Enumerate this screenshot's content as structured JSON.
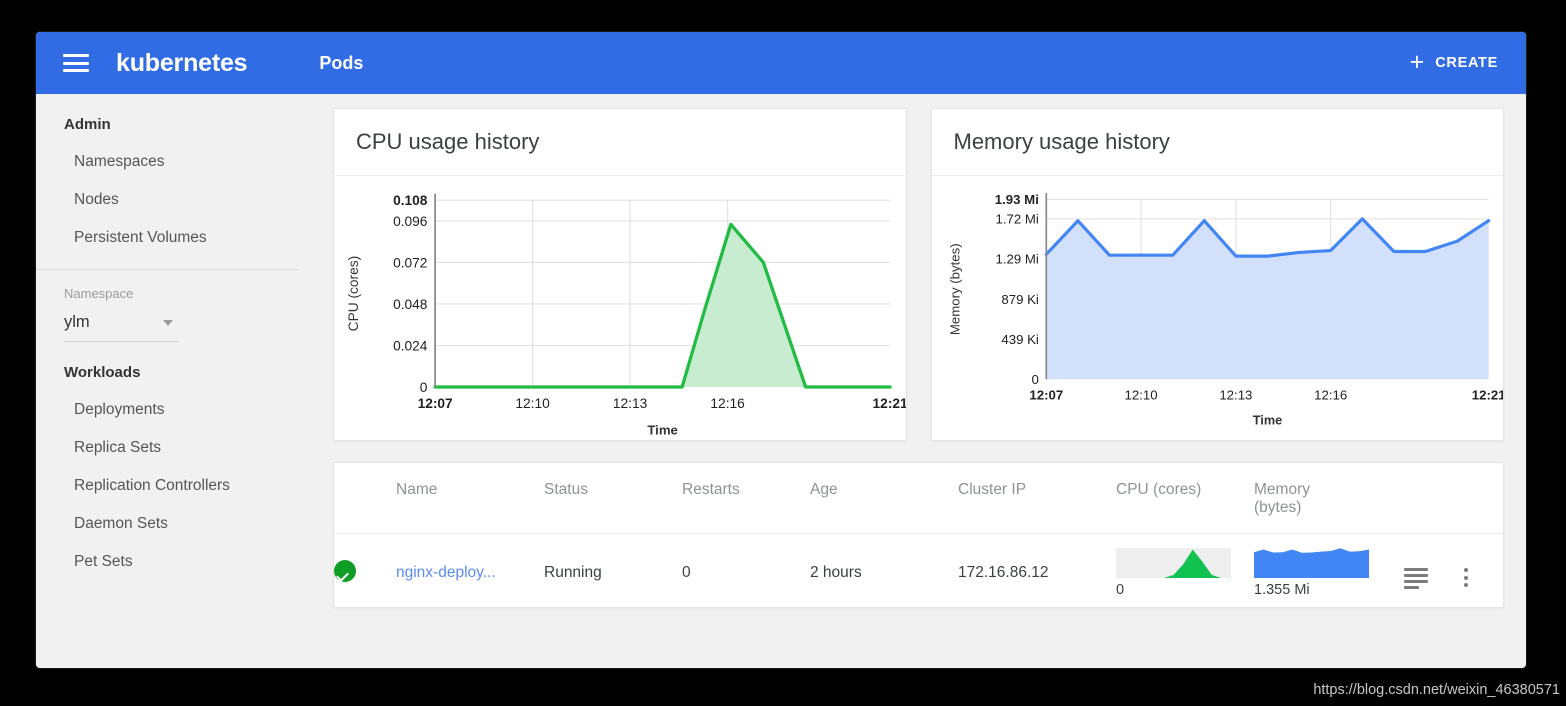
{
  "topbar": {
    "menu_icon": "hamburger-icon",
    "brand": "kubernetes",
    "page_title": "Pods",
    "create_plus": "+",
    "create_label": "CREATE"
  },
  "sidebar": {
    "sections": [
      {
        "header": "Admin",
        "items": [
          "Namespaces",
          "Nodes",
          "Persistent Volumes"
        ]
      },
      {
        "header": "Workloads",
        "items": [
          "Deployments",
          "Replica Sets",
          "Replication Controllers",
          "Daemon Sets",
          "Pet Sets"
        ]
      }
    ],
    "namespace_label": "Namespace",
    "namespace_value": "ylm"
  },
  "colors": {
    "header_blue": "#326ce5",
    "cpu_green": "#22bb44",
    "cpu_green_fill": "#c8ecd0",
    "memory_blue": "#4285f4",
    "memory_blue_fill": "#d3e0fb",
    "status_green": "#0f9d26",
    "link_blue": "#5b8def"
  },
  "cards": {
    "cpu_title": "CPU usage history",
    "memory_title": "Memory usage history"
  },
  "chart_data": [
    {
      "type": "area",
      "title": "CPU usage history",
      "xlabel": "Time",
      "ylabel": "CPU (cores)",
      "yticks": [
        "0",
        "0.024",
        "0.048",
        "0.072",
        "0.096",
        "0.108"
      ],
      "ytick_values": [
        0,
        0.024,
        0.048,
        0.072,
        0.096,
        0.108
      ],
      "ylim": [
        0,
        0.108
      ],
      "xticks": [
        "12:07",
        "12:10",
        "12:13",
        "12:16",
        "12:21"
      ],
      "xtick_minutes": [
        7,
        10,
        13,
        16,
        21
      ],
      "xlim_minutes": [
        7,
        21
      ],
      "grid": true,
      "series": [
        {
          "name": "CPU (cores)",
          "x_minutes": [
            7,
            8,
            9,
            10,
            11,
            12,
            13,
            14,
            14.6,
            15.3,
            16.1,
            17.1,
            18.4,
            19.2,
            20.1,
            21
          ],
          "values": [
            0,
            0,
            0,
            0,
            0,
            0,
            0,
            0,
            0,
            0.045,
            0.094,
            0.072,
            0,
            0,
            0,
            0
          ]
        }
      ]
    },
    {
      "type": "area",
      "title": "Memory usage history",
      "xlabel": "Time",
      "ylabel": "Memory (bytes)",
      "yticks": [
        "0",
        "439 Ki",
        "879 Ki",
        "1.29 Mi",
        "1.72 Mi",
        "1.93 Mi"
      ],
      "ytick_values": [
        0,
        0.429,
        0.858,
        1.29,
        1.72,
        1.93
      ],
      "ylim": [
        0,
        1.93
      ],
      "xticks": [
        "12:07",
        "12:10",
        "12:13",
        "12:16",
        "12:21"
      ],
      "xtick_minutes": [
        7,
        10,
        13,
        16,
        21
      ],
      "xlim_minutes": [
        7,
        21
      ],
      "grid": true,
      "series": [
        {
          "name": "Memory (bytes)",
          "x_minutes": [
            7,
            8,
            9,
            10,
            11,
            12,
            13,
            14,
            15,
            16,
            17,
            18,
            19,
            20,
            21
          ],
          "values": [
            1.34,
            1.7,
            1.33,
            1.33,
            1.33,
            1.7,
            1.32,
            1.32,
            1.36,
            1.38,
            1.72,
            1.37,
            1.37,
            1.48,
            1.7
          ]
        }
      ]
    }
  ],
  "table": {
    "headers": [
      "",
      "Name",
      "Status",
      "Restarts",
      "Age",
      "Cluster IP",
      "CPU (cores)",
      "Memory (bytes)"
    ],
    "memory_header_line1": "Memory",
    "memory_header_line2": "(bytes)",
    "rows": [
      {
        "status_icon": "check-circle-icon",
        "name": "nginx-deploy...",
        "status": "Running",
        "restarts": "0",
        "age": "2 hours",
        "cluster_ip": "172.16.86.12",
        "cpu_value": "0",
        "memory_value": "1.355 Mi",
        "cpu_spark": [
          0,
          0,
          0,
          0,
          0,
          0,
          0.1,
          0.45,
          0.95,
          0.55,
          0.1,
          0,
          0
        ],
        "memory_spark": [
          0.86,
          0.95,
          0.85,
          0.86,
          0.95,
          0.84,
          0.85,
          0.88,
          0.9,
          0.99,
          0.88,
          0.89,
          0.95
        ],
        "logs_icon": "logs-icon",
        "menu_icon": "kebab-menu-icon"
      }
    ]
  },
  "watermark": "https://blog.csdn.net/weixin_46380571"
}
